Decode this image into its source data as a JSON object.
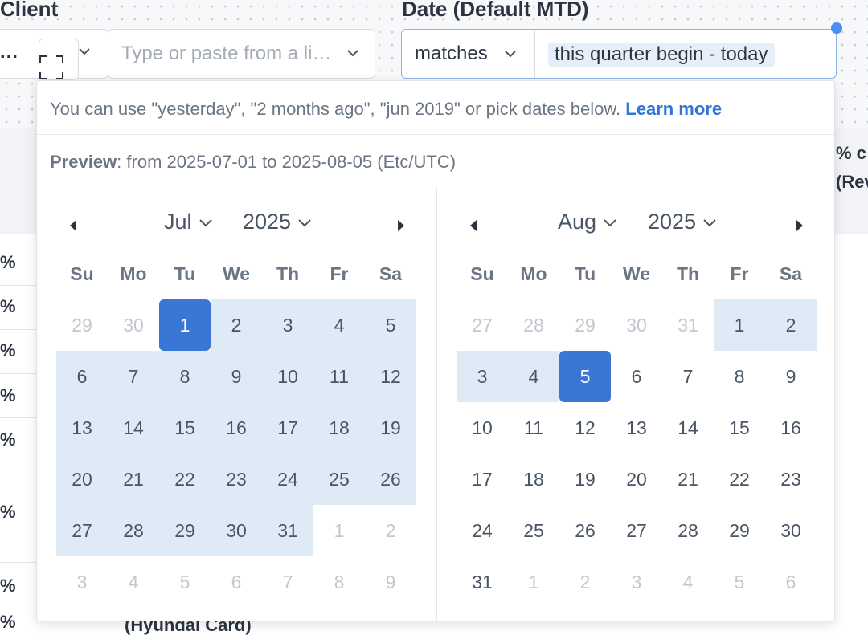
{
  "filters": {
    "client": {
      "label": "Client",
      "ellipsis": "…",
      "placeholder": "Type or paste from a li…"
    },
    "date": {
      "label": "Date (Default MTD)",
      "operator": "matches",
      "value": "this quarter begin - today"
    }
  },
  "background": {
    "percent_sign": "%",
    "header_text_1": "% c",
    "header_text_2": "(Rev",
    "row_text": "(Hyundai Card)"
  },
  "popup": {
    "hint": "You can use \"yesterday\", \"2 months ago\", \"jun 2019\" or pick dates below.",
    "learn_more": "Learn more",
    "preview_label": "Preview",
    "preview_text": ": from 2025-07-01 to 2025-08-05 (Etc/UTC)",
    "weekdays": [
      "Su",
      "Mo",
      "Tu",
      "We",
      "Th",
      "Fr",
      "Sa"
    ],
    "left": {
      "month": "Jul",
      "year": "2025",
      "weeks": [
        [
          {
            "d": "29",
            "s": "out"
          },
          {
            "d": "30",
            "s": "out"
          },
          {
            "d": "1",
            "s": "sel"
          },
          {
            "d": "2",
            "s": "range"
          },
          {
            "d": "3",
            "s": "range"
          },
          {
            "d": "4",
            "s": "range"
          },
          {
            "d": "5",
            "s": "range"
          }
        ],
        [
          {
            "d": "6",
            "s": "range"
          },
          {
            "d": "7",
            "s": "range"
          },
          {
            "d": "8",
            "s": "range"
          },
          {
            "d": "9",
            "s": "range"
          },
          {
            "d": "10",
            "s": "range"
          },
          {
            "d": "11",
            "s": "range"
          },
          {
            "d": "12",
            "s": "range"
          }
        ],
        [
          {
            "d": "13",
            "s": "range"
          },
          {
            "d": "14",
            "s": "range"
          },
          {
            "d": "15",
            "s": "range"
          },
          {
            "d": "16",
            "s": "range"
          },
          {
            "d": "17",
            "s": "range"
          },
          {
            "d": "18",
            "s": "range"
          },
          {
            "d": "19",
            "s": "range"
          }
        ],
        [
          {
            "d": "20",
            "s": "range"
          },
          {
            "d": "21",
            "s": "range"
          },
          {
            "d": "22",
            "s": "range"
          },
          {
            "d": "23",
            "s": "range"
          },
          {
            "d": "24",
            "s": "range"
          },
          {
            "d": "25",
            "s": "range"
          },
          {
            "d": "26",
            "s": "range"
          }
        ],
        [
          {
            "d": "27",
            "s": "range"
          },
          {
            "d": "28",
            "s": "range"
          },
          {
            "d": "29",
            "s": "range"
          },
          {
            "d": "30",
            "s": "range"
          },
          {
            "d": "31",
            "s": "range"
          },
          {
            "d": "1",
            "s": "out"
          },
          {
            "d": "2",
            "s": "out"
          }
        ],
        [
          {
            "d": "3",
            "s": "out"
          },
          {
            "d": "4",
            "s": "out"
          },
          {
            "d": "5",
            "s": "out"
          },
          {
            "d": "6",
            "s": "out"
          },
          {
            "d": "7",
            "s": "out"
          },
          {
            "d": "8",
            "s": "out"
          },
          {
            "d": "9",
            "s": "out"
          }
        ]
      ]
    },
    "right": {
      "month": "Aug",
      "year": "2025",
      "weeks": [
        [
          {
            "d": "27",
            "s": "out"
          },
          {
            "d": "28",
            "s": "out"
          },
          {
            "d": "29",
            "s": "out"
          },
          {
            "d": "30",
            "s": "out"
          },
          {
            "d": "31",
            "s": "out"
          },
          {
            "d": "1",
            "s": "range"
          },
          {
            "d": "2",
            "s": "range"
          }
        ],
        [
          {
            "d": "3",
            "s": "range"
          },
          {
            "d": "4",
            "s": "range"
          },
          {
            "d": "5",
            "s": "sel"
          },
          {
            "d": "6",
            "s": "in"
          },
          {
            "d": "7",
            "s": "in"
          },
          {
            "d": "8",
            "s": "in"
          },
          {
            "d": "9",
            "s": "in"
          }
        ],
        [
          {
            "d": "10",
            "s": "in"
          },
          {
            "d": "11",
            "s": "in"
          },
          {
            "d": "12",
            "s": "in"
          },
          {
            "d": "13",
            "s": "in"
          },
          {
            "d": "14",
            "s": "in"
          },
          {
            "d": "15",
            "s": "in"
          },
          {
            "d": "16",
            "s": "in"
          }
        ],
        [
          {
            "d": "17",
            "s": "in"
          },
          {
            "d": "18",
            "s": "in"
          },
          {
            "d": "19",
            "s": "in"
          },
          {
            "d": "20",
            "s": "in"
          },
          {
            "d": "21",
            "s": "in"
          },
          {
            "d": "22",
            "s": "in"
          },
          {
            "d": "23",
            "s": "in"
          }
        ],
        [
          {
            "d": "24",
            "s": "in"
          },
          {
            "d": "25",
            "s": "in"
          },
          {
            "d": "26",
            "s": "in"
          },
          {
            "d": "27",
            "s": "in"
          },
          {
            "d": "28",
            "s": "in"
          },
          {
            "d": "29",
            "s": "in"
          },
          {
            "d": "30",
            "s": "in"
          }
        ],
        [
          {
            "d": "31",
            "s": "in"
          },
          {
            "d": "1",
            "s": "out"
          },
          {
            "d": "2",
            "s": "out"
          },
          {
            "d": "3",
            "s": "out"
          },
          {
            "d": "4",
            "s": "out"
          },
          {
            "d": "5",
            "s": "out"
          },
          {
            "d": "6",
            "s": "out"
          }
        ]
      ]
    }
  },
  "colors": {
    "accent": "#3a76d6",
    "range_fill": "#dfeaf7",
    "link": "#2f74d6"
  }
}
